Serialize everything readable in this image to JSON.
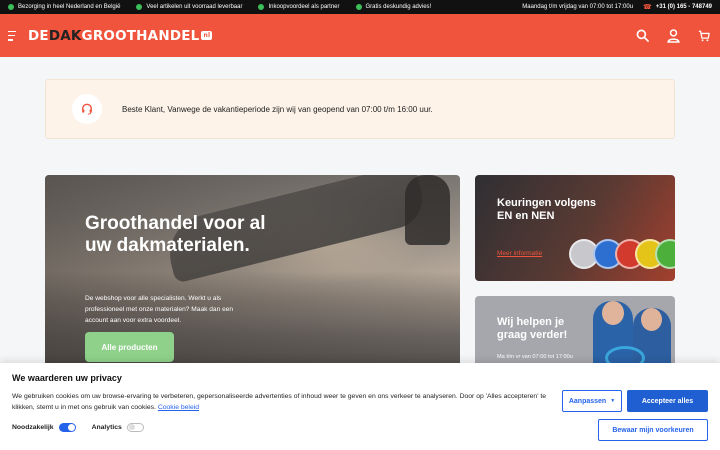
{
  "topbar": {
    "usps": [
      {
        "icon": "truck-icon",
        "label": "Bezorging in heel Nederland en België"
      },
      {
        "icon": "check-icon",
        "label": "Veel artikelen uit voorraad leverbaar"
      },
      {
        "icon": "check-icon",
        "label": "Inkoopvoordeel als partner"
      },
      {
        "icon": "thumbs-up-icon",
        "label": "Gratis deskundig advies!"
      }
    ],
    "hours": "Maandag t/m vrijdag van 07:00 tot 17:00u",
    "phone": "+31 (0) 165 - 748749"
  },
  "header": {
    "logo_pre": "DE",
    "logo_mid": "DAK",
    "logo_post": "GROOTHANDEL",
    "logo_tld": "nl",
    "icons": [
      "search-icon",
      "user-icon",
      "cart-icon"
    ],
    "accent": "#f0543c"
  },
  "notice": {
    "icon": "headset-icon",
    "text": "Beste Klant, Vanwege de vakantieperiode zijn wij van geopend van 07:00 t/m 16:00 uur."
  },
  "hero": {
    "title": "Groothandel voor al uw dakmaterialen.",
    "description": "De webshop voor alle specialisten. Werkt u als professioneel met onze materialen? Maak dan een account aan voor extra voordeel.",
    "cta": "Alle producten"
  },
  "card_inspections": {
    "title": "Keuringen volgens EN en NEN",
    "link": "Meer informatie"
  },
  "card_help": {
    "title": "Wij helpen je graag verder!",
    "hours": "Ma t/m vr van 07:00 tot 17:00u"
  },
  "cookie": {
    "title": "We waarderen uw privacy",
    "text": "We gebruiken cookies om uw browse-ervaring te verbeteren, gepersonaliseerde advertenties of inhoud weer te geven en ons verkeer te analyseren. Door op 'Alles accepteren' te klikken, stemt u in met ons gebruik van cookies.",
    "policy_link": "Cookie beleid",
    "toggle_necessary": "Noodzakelijk",
    "toggle_analytics": "Analytics",
    "adjust_button": "Aanpassen",
    "accept_button": "Accepteer alles",
    "save_button": "Bewaar mijn voorkeuren"
  }
}
